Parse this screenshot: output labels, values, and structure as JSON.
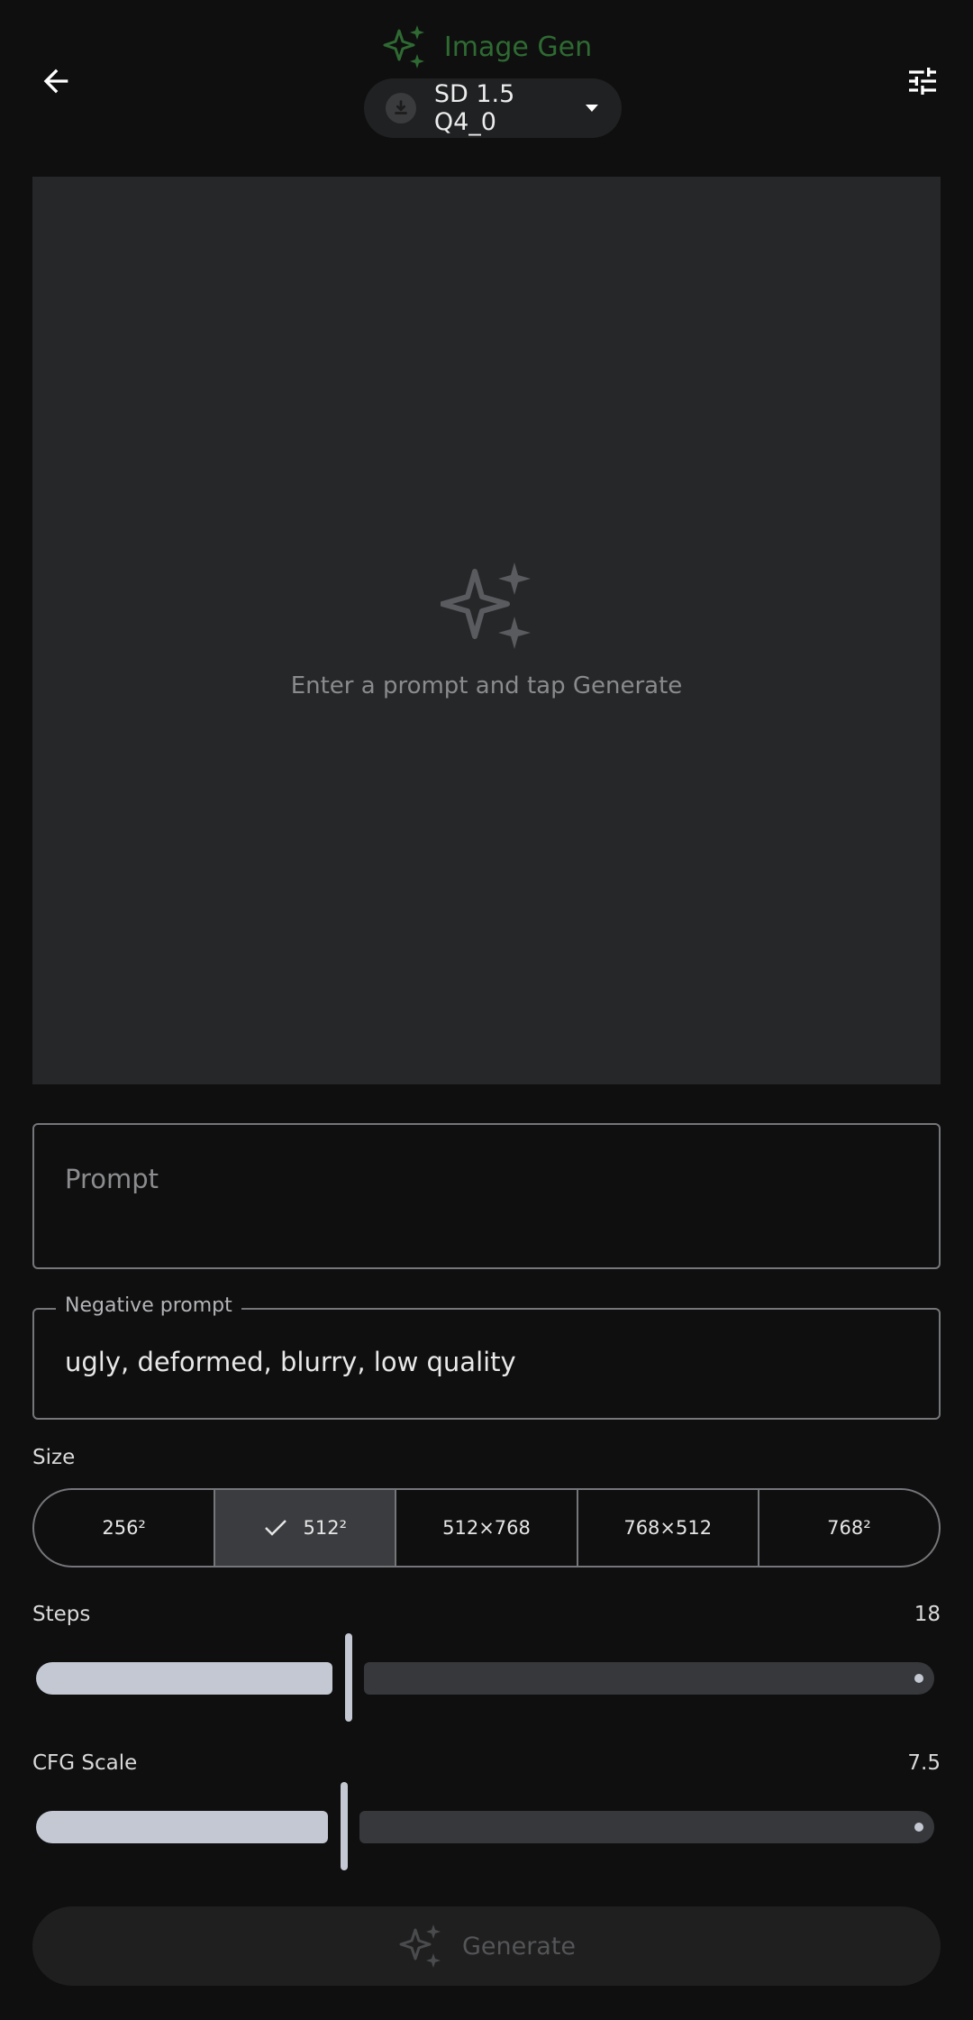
{
  "header": {
    "title": "Image Gen",
    "model": {
      "name": "SD 1.5 Q4_0"
    },
    "icons": {
      "back": "arrow-left-icon",
      "settings": "tune-icon",
      "title": "sparkles-icon"
    }
  },
  "preview": {
    "hint": "Enter a prompt and tap Generate"
  },
  "prompt": {
    "placeholder": "Prompt",
    "value": ""
  },
  "negative_prompt": {
    "label": "Negative prompt",
    "value": "ugly, deformed, blurry, low quality"
  },
  "size": {
    "label": "Size",
    "options": [
      "256²",
      "512²",
      "512×768",
      "768×512",
      "768²"
    ],
    "selected": "512²"
  },
  "steps": {
    "label": "Steps",
    "value": "18"
  },
  "cfg": {
    "label": "CFG Scale",
    "value": "7.5"
  },
  "generate": {
    "label": "Generate",
    "enabled": false
  },
  "colors": {
    "accent_green": "#2e6a32",
    "background": "#0f0f0f",
    "surface": "#262729",
    "slider": "#c3c8d2"
  }
}
